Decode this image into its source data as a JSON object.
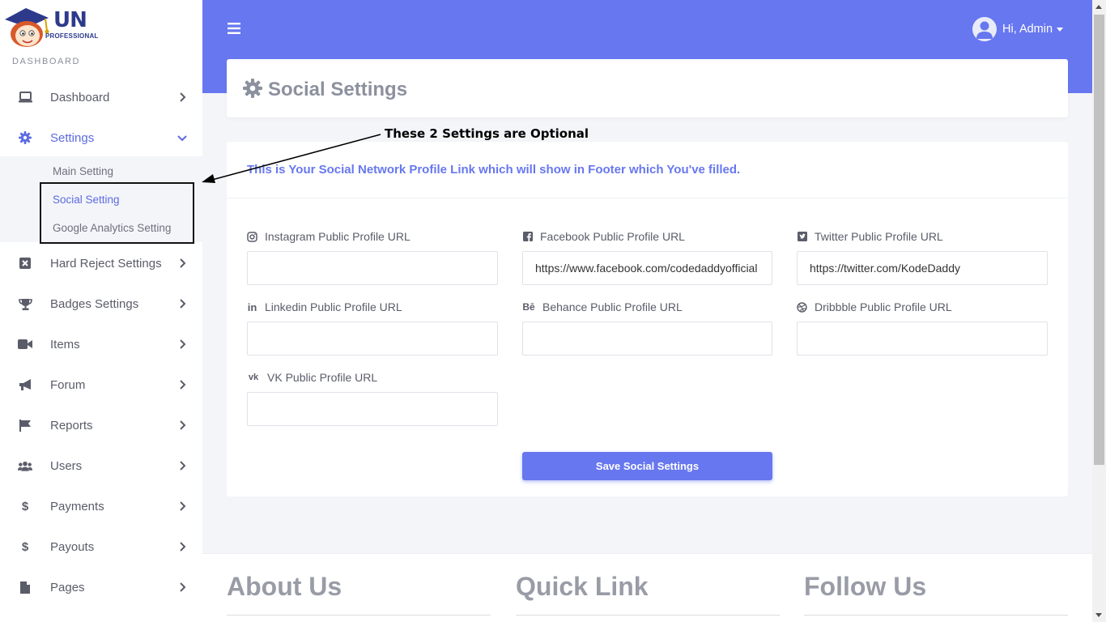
{
  "brand": {
    "logo_text": "UN",
    "logo_sub": "PROFESSIONAL"
  },
  "sidebar": {
    "heading": "DASHBOARD",
    "items": [
      {
        "label": "Dashboard",
        "icon": "laptop-icon"
      },
      {
        "label": "Settings",
        "icon": "gear-icon",
        "expanded": true
      },
      {
        "label": "Hard Reject Settings",
        "icon": "square-x-icon"
      },
      {
        "label": "Badges Settings",
        "icon": "trophy-icon"
      },
      {
        "label": "Items",
        "icon": "video-icon"
      },
      {
        "label": "Forum",
        "icon": "megaphone-icon"
      },
      {
        "label": "Reports",
        "icon": "flag-icon"
      },
      {
        "label": "Users",
        "icon": "users-icon"
      },
      {
        "label": "Payments",
        "icon": "dollar-icon"
      },
      {
        "label": "Payouts",
        "icon": "dollar-icon"
      },
      {
        "label": "Pages",
        "icon": "file-icon"
      }
    ],
    "settings_submenu": [
      "Main Setting",
      "Social Setting",
      "Google Analytics Setting"
    ],
    "active_submenu": "Social Setting"
  },
  "topbar": {
    "user_greeting": "Hi, Admin"
  },
  "page": {
    "title": "Social Settings",
    "info_text": "This is Your Social Network Profile Link which will show in Footer which You've filled.",
    "fields": [
      {
        "label": "Instagram Public Profile URL",
        "value": "",
        "icon": "instagram-icon"
      },
      {
        "label": "Facebook Public Profile URL",
        "value": "https://www.facebook.com/codedaddyofficial",
        "icon": "facebook-icon"
      },
      {
        "label": "Twitter Public Profile URL",
        "value": "https://twitter.com/KodeDaddy",
        "icon": "twitter-icon"
      },
      {
        "label": "Linkedin Public Profile URL",
        "value": "",
        "icon": "linkedin-icon"
      },
      {
        "label": "Behance Public Profile URL",
        "value": "",
        "icon": "behance-icon"
      },
      {
        "label": "Dribbble Public Profile URL",
        "value": "",
        "icon": "dribbble-icon"
      },
      {
        "label": "VK Public Profile URL",
        "value": "",
        "icon": "vk-icon"
      }
    ],
    "save_label": "Save Social Settings"
  },
  "annotation": {
    "text": "These 2 Settings are Optional"
  },
  "footer": {
    "headings": [
      "About Us",
      "Quick Link",
      "Follow Us"
    ]
  },
  "colors": {
    "accent": "#6777ef",
    "text": "#5a5c69",
    "muted": "#8c919e"
  }
}
